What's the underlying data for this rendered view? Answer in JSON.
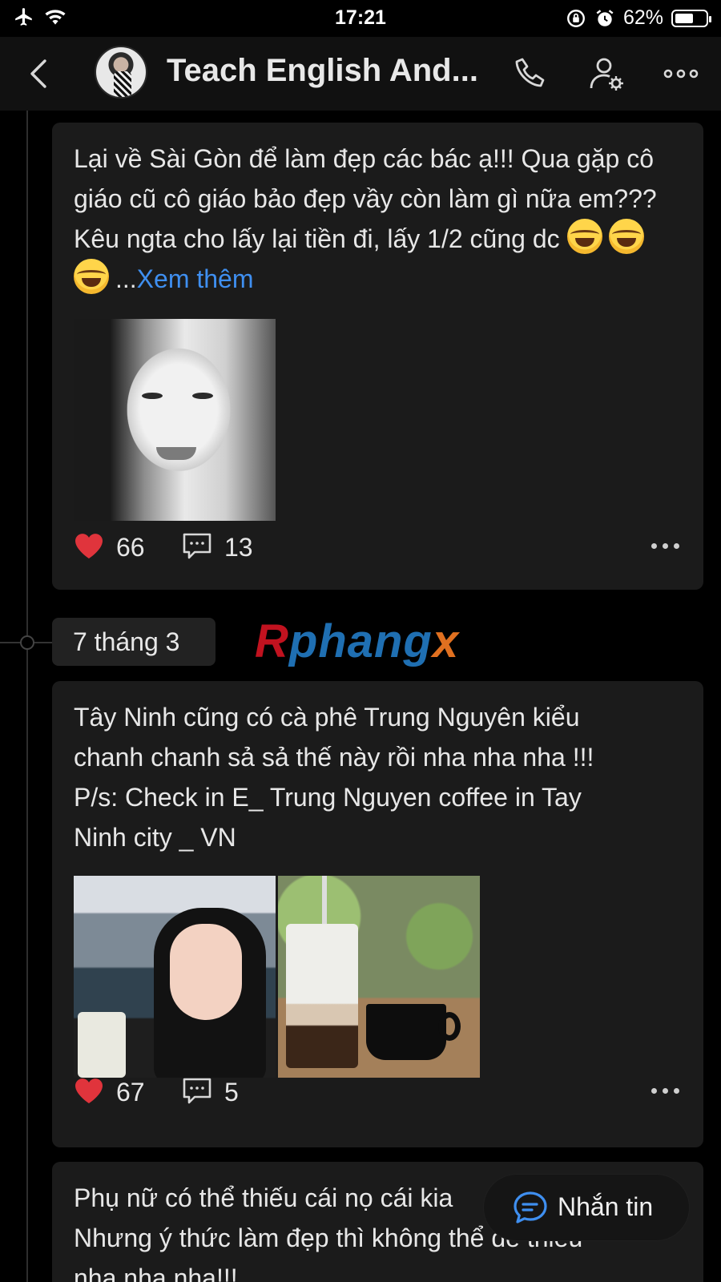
{
  "status_bar": {
    "time": "17:21",
    "battery": "62%",
    "battery_level": 0.62
  },
  "header": {
    "title": "Teach English And..."
  },
  "posts": [
    {
      "text": "Lại về Sài Gòn để làm đẹp các bác ạ!!! Qua gặp cô giáo cũ cô giáo bảo đẹp vầy còn làm gì nữa em??? Kêu ngta cho lấy lại tiền đi, lấy 1/2 cũng dc",
      "ellipsis": "...",
      "see_more": "Xem thêm",
      "likes": "66",
      "comments": "13"
    },
    {
      "text_lines": [
        "Tây Ninh cũng có cà phê Trung Nguyên kiểu",
        "chanh chanh sả sả thế này rồi nha nha nha !!!",
        "P/s: Check in E_ Trung Nguyen coffee in Tay",
        "Ninh city _ VN"
      ],
      "likes": "67",
      "comments": "5"
    },
    {
      "text_lines": [
        "Phụ nữ có thể thiếu cái nọ cái kia",
        "Nhưng ý thức làm đẹp thì không thể để thiếu",
        "nha nha nha!!!"
      ]
    }
  ],
  "date_separator": "7 tháng 3",
  "watermark": {
    "part1": "R",
    "part2": "phang",
    "part3": "x"
  },
  "fab": {
    "label": "Nhắn tin"
  },
  "colors": {
    "link": "#3f8ff0",
    "like": "#e0343c",
    "card": "#1b1b1b",
    "background": "#000000"
  }
}
